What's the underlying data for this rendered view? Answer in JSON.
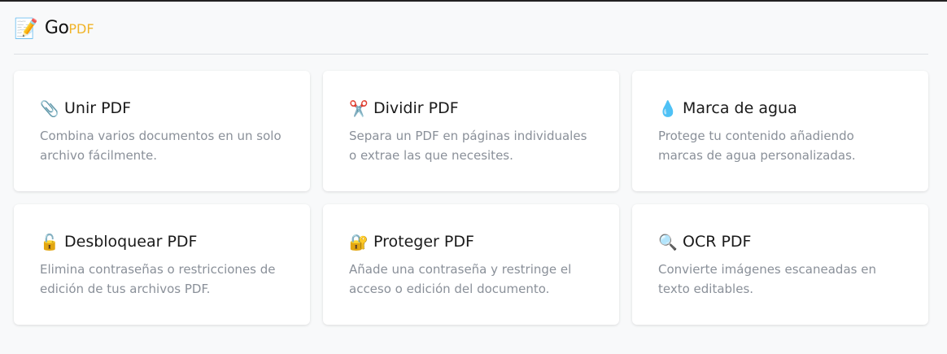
{
  "header": {
    "logo_icon": "📝",
    "logo_icon_name": "memo-icon",
    "logo_main": "Go",
    "logo_accent": "PDF",
    "accent_color": "#f0b429"
  },
  "tools": [
    {
      "icon": "📎",
      "icon_name": "paperclip-icon",
      "title": "Unir PDF",
      "desc": "Combina varios documentos en un solo archivo fácilmente."
    },
    {
      "icon": "✂️",
      "icon_name": "scissors-icon",
      "title": "Dividir PDF",
      "desc": "Separa un PDF en páginas individuales o extrae las que necesites."
    },
    {
      "icon": "💧",
      "icon_name": "droplet-icon",
      "title": "Marca de agua",
      "desc": "Protege tu contenido añadiendo marcas de agua personalizadas."
    },
    {
      "icon": "🔓",
      "icon_name": "unlock-icon",
      "title": "Desbloquear PDF",
      "desc": "Elimina contraseñas o restricciones de edición de tus archivos PDF."
    },
    {
      "icon": "🔐",
      "icon_name": "lock-with-key-icon",
      "title": "Proteger PDF",
      "desc": "Añade una contraseña y restringe el acceso o edición del documento."
    },
    {
      "icon": "🔍",
      "icon_name": "magnifier-icon",
      "title": "OCR PDF",
      "desc": "Convierte imágenes escaneadas en texto editables."
    }
  ]
}
